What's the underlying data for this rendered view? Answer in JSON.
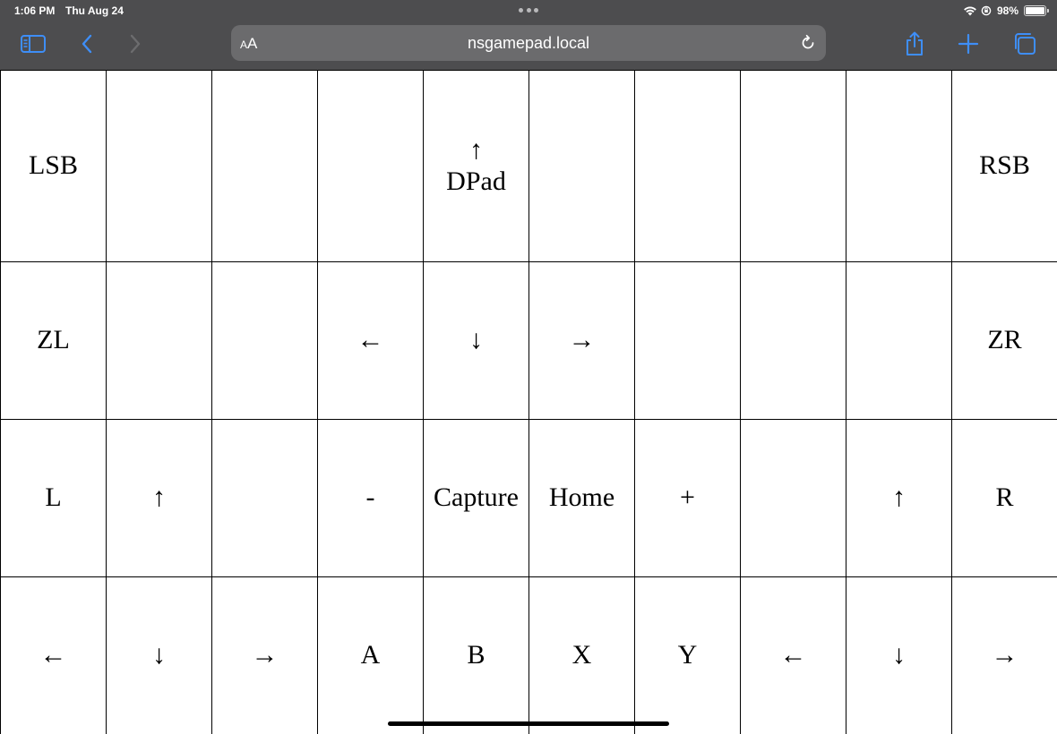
{
  "status_bar": {
    "time": "1:06 PM",
    "date": "Thu Aug 24",
    "battery": "98%",
    "battery_level": 0.98
  },
  "toolbar": {
    "url": "nsgamepad.local",
    "aa_label_small": "A",
    "aa_label_large": "A"
  },
  "colors": {
    "chrome_bg": "#4d4d4f",
    "url_bg": "#6b6b6d",
    "accent": "#3e8ef7"
  },
  "grid": {
    "rows": [
      [
        {
          "label": "LSB",
          "name": "pad-lsb-button"
        },
        {
          "label": "",
          "name": "pad-empty-cell"
        },
        {
          "label": "",
          "name": "pad-empty-cell"
        },
        {
          "label": "",
          "name": "pad-empty-cell"
        },
        {
          "label": "↑\nDPad",
          "name": "pad-dpad-up-button"
        },
        {
          "label": "",
          "name": "pad-empty-cell"
        },
        {
          "label": "",
          "name": "pad-empty-cell"
        },
        {
          "label": "",
          "name": "pad-empty-cell"
        },
        {
          "label": "",
          "name": "pad-empty-cell"
        },
        {
          "label": "RSB",
          "name": "pad-rsb-button"
        }
      ],
      [
        {
          "label": "ZL",
          "name": "pad-zl-button"
        },
        {
          "label": "",
          "name": "pad-empty-cell"
        },
        {
          "label": "",
          "name": "pad-empty-cell"
        },
        {
          "label": "←",
          "name": "pad-dpad-left-button"
        },
        {
          "label": "↓",
          "name": "pad-dpad-down-button"
        },
        {
          "label": "→",
          "name": "pad-dpad-right-button"
        },
        {
          "label": "",
          "name": "pad-empty-cell"
        },
        {
          "label": "",
          "name": "pad-empty-cell"
        },
        {
          "label": "",
          "name": "pad-empty-cell"
        },
        {
          "label": "ZR",
          "name": "pad-zr-button"
        }
      ],
      [
        {
          "label": "L",
          "name": "pad-l-button"
        },
        {
          "label": "↑",
          "name": "pad-left-stick-up-button"
        },
        {
          "label": "",
          "name": "pad-empty-cell"
        },
        {
          "label": "-",
          "name": "pad-minus-button"
        },
        {
          "label": "Capture",
          "name": "pad-capture-button"
        },
        {
          "label": "Home",
          "name": "pad-home-button"
        },
        {
          "label": "+",
          "name": "pad-plus-button"
        },
        {
          "label": "",
          "name": "pad-empty-cell"
        },
        {
          "label": "↑",
          "name": "pad-right-stick-up-button"
        },
        {
          "label": "R",
          "name": "pad-r-button"
        }
      ],
      [
        {
          "label": "←",
          "name": "pad-left-stick-left-button"
        },
        {
          "label": "↓",
          "name": "pad-left-stick-down-button"
        },
        {
          "label": "→",
          "name": "pad-left-stick-right-button"
        },
        {
          "label": "A",
          "name": "pad-a-button"
        },
        {
          "label": "B",
          "name": "pad-b-button"
        },
        {
          "label": "X",
          "name": "pad-x-button"
        },
        {
          "label": "Y",
          "name": "pad-y-button"
        },
        {
          "label": "←",
          "name": "pad-right-stick-left-button"
        },
        {
          "label": "↓",
          "name": "pad-right-stick-down-button"
        },
        {
          "label": "→",
          "name": "pad-right-stick-right-button"
        }
      ]
    ]
  }
}
